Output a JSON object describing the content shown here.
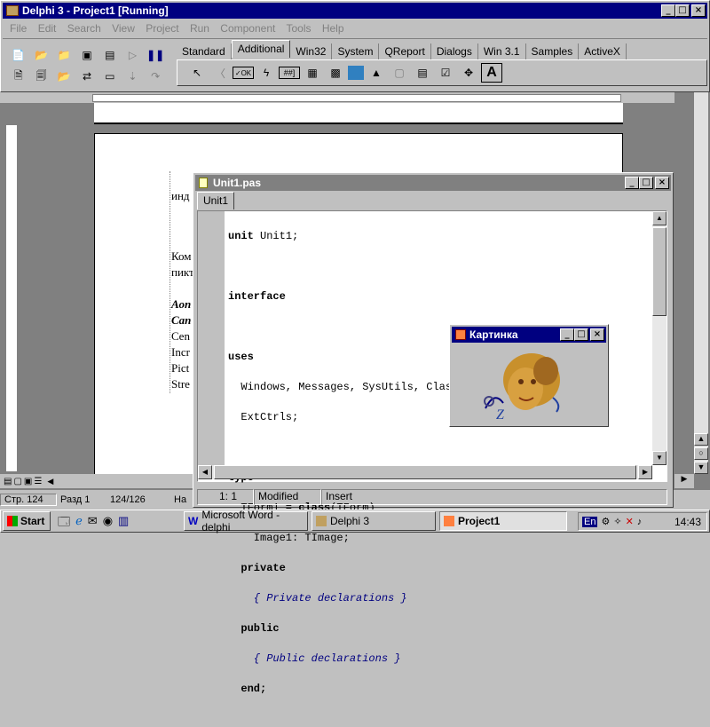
{
  "delphi": {
    "title": "Delphi 3 - Project1 [Running]",
    "menu": [
      "File",
      "Edit",
      "Search",
      "View",
      "Project",
      "Run",
      "Component",
      "Tools",
      "Help"
    ],
    "palette_tabs": [
      "Standard",
      "Additional",
      "Win32",
      "System",
      "QReport",
      "Dialogs",
      "Win 3.1",
      "Samples",
      "ActiveX"
    ],
    "active_tab": "Additional"
  },
  "word": {
    "doc_snippets": [
      "инд",
      "Ком",
      "пикт",
      "Аоп",
      "Can",
      "Cen",
      "Incr",
      "Pict",
      "Stre"
    ],
    "status": {
      "page": "Стр. 124",
      "section": "Разд 1",
      "pages": "124/126",
      "extra": "На"
    }
  },
  "unit_window": {
    "title": "Unit1.pas",
    "tab": "Unit1",
    "status": {
      "position": "1:  1",
      "state": "Modified",
      "mode": "Insert"
    },
    "code": {
      "l1a": "unit",
      "l1b": " Unit1;",
      "l3": "interface",
      "l5": "uses",
      "l6": "  Windows, Messages, SysUtils, Classes, Graphics, Controls,",
      "l7": "  ExtCtrls;",
      "l9": "type",
      "l10a": "  TForm1 = ",
      "l10b": "class",
      "l10c": "(TForm)",
      "l11": "    Image1: TImage;",
      "l12": "  private",
      "l13": "    { Private declarations }",
      "l14": "  public",
      "l15": "    { Public declarations }",
      "l16": "  end;"
    }
  },
  "picture_form": {
    "title": "Картинка"
  },
  "taskbar": {
    "start": "Start",
    "tasks": [
      "Microsoft Word - delphi",
      "Delphi 3",
      "Project1"
    ],
    "lang": "En",
    "clock": "14:43"
  }
}
